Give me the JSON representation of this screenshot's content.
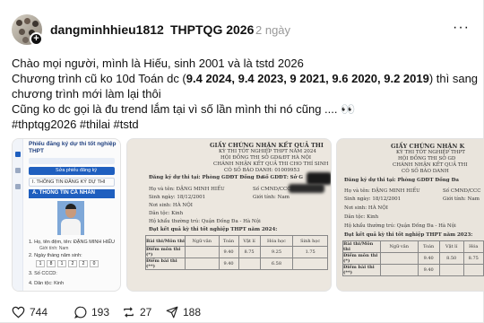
{
  "header": {
    "username": "dangminhhieu1812",
    "separator": "›",
    "community": "THPTQG 2026",
    "time": "2 ngày",
    "more": "···"
  },
  "post": {
    "line1": "Chào mọi người, mình là Hiếu, sinh 2001 và là tstd 2026",
    "line2a": "Chương trình cũ ko 10d Toán dc (",
    "line2b": "9.4 2024, 9.4 2023, 9 2021, 9.6 2020, 9.2 2019",
    "line2c": ") thì sang",
    "line3": "chương trình mới làm lại thôi",
    "line4": "Cũng ko dc gọi là đu trend lắm tại vì số lần mình thi nó cũng .... 👀",
    "tags": "#thptqg2026 #thilai #tstd"
  },
  "image1": {
    "title": "Phiếu đăng ký dự thi tốt nghiệp THPT",
    "button1": "Sửa phiếu đăng ký",
    "section": "I. THÔNG TIN ĐĂNG KÝ DỰ THI",
    "subsection": "A. THÔNG TIN CÁ NHÂN",
    "field1": "1. Họ, tên đệm, tên: ĐẶNG MINH HIẾU",
    "field1b": "Giới tính: Nam",
    "field2": "2. Ngày tháng năm sinh:",
    "digits": [
      "1",
      "8",
      "1",
      "2",
      "2",
      "0"
    ],
    "field3": "3. Số CCCD:",
    "field4": "4. Dân tộc: Kinh"
  },
  "image2": {
    "title": "GIẤY CHỨNG NHẬN KẾT QUẢ THI",
    "line1": "KỲ THI TỐT NGHIỆP THPT NĂM 2024",
    "line2": "HỘI ĐỒNG THI SỞ GD&ĐT HÀ NỘI",
    "line3": "CHÁNH NHẬN KẾT QUẢ THI CHO THÍ SINH",
    "line4": "CÓ SỐ BÁO DANH: 01009953",
    "reg": "Đăng ký dự thi tại: Phòng GDĐT Đống Đa",
    "sbd": "Số GDĐT: Sở G",
    "name": "Họ và tên: ĐẶNG MINH HIẾU",
    "cmnd": "Số CMND/CCCD",
    "dob": "Sinh ngày: 18/12/2001",
    "gender": "Giới tính: Nam",
    "birthplace": "Nơi sinh: HÀ NỘI",
    "ethnic": "Dân tộc: Kinh",
    "address": "Hộ khẩu thường trú: Quận Đống Đa - Hà Nội",
    "result": "Đạt kết quả kỳ thi tốt nghiệp THPT năm 2024:",
    "cols": [
      "Bài thi/Môn thi",
      "Ngữ văn",
      "Toán",
      "Vật lí",
      "Hóa học",
      "Sinh học"
    ],
    "row1": [
      "Điểm môn thi (*)",
      "",
      "9.40",
      "8.75",
      "9.25",
      "1.75"
    ],
    "row2": [
      "Điểm bài thi (**)",
      "",
      "9.40",
      "",
      "6.58",
      ""
    ],
    "khtn": "KHTN"
  },
  "image3": {
    "title": "GIẤY CHỨNG NHẬN K",
    "line1": "KỲ THI TỐT NGHIỆP THPT",
    "line2": "HỘI ĐỒNG THI SỞ GD",
    "line3": "CHÁNH NHẬN KẾT QUẢ THI",
    "line4": "CÓ SỐ BÁO DANH",
    "reg": "Đăng ký dự thi tại: Phòng GDĐT Đống Đa",
    "name": "Họ và tên: ĐẶNG MINH HIẾU",
    "cmnd": "Số CMND/CCC",
    "dob": "Sinh ngày: 18/12/2001",
    "gender": "Giới tính: Nam",
    "birthplace": "Nơi sinh: HÀ NỘI",
    "ethnic": "Dân tộc: Kinh",
    "address": "Hộ khẩu thường trú: Quận Đống Đa - Hà Nội",
    "result": "Đạt kết quả kỳ thi tốt nghiệp THPT năm 2023:",
    "cols": [
      "Bài thi/Môn thi",
      "Ngữ văn",
      "Toán",
      "Vật lí",
      "Hóa"
    ],
    "row1": [
      "Điểm môn thi (*)",
      "",
      "9.40",
      "8.50",
      "8.75"
    ],
    "row2": [
      "Điểm bài thi (**)",
      "",
      "9.40",
      "",
      ""
    ],
    "khtn": "KHTN"
  },
  "actions": {
    "likes": "744",
    "comments": "193",
    "reposts": "27",
    "shares": "188"
  },
  "colors": {
    "accent_bold": "#111111",
    "muted": "#999999",
    "form_blue": "#1f5fbf"
  }
}
